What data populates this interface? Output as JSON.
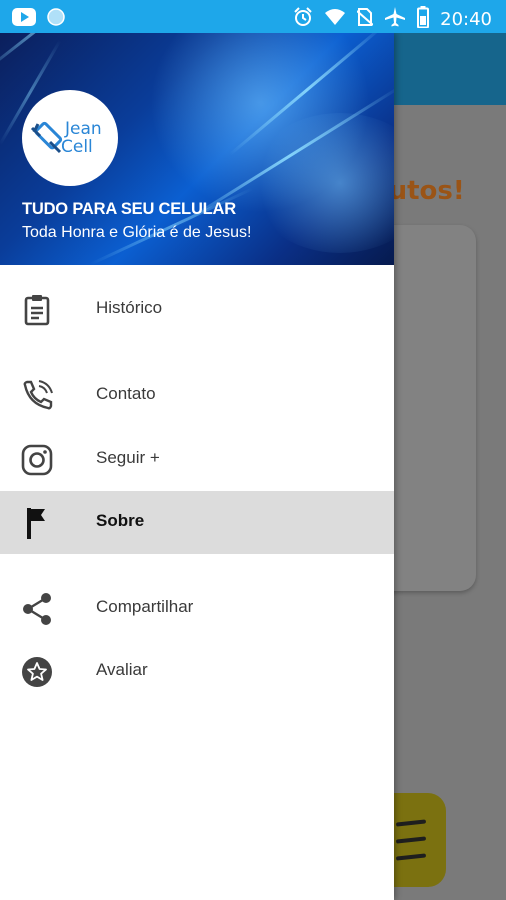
{
  "status_bar": {
    "time": "20:40",
    "left_icons": [
      "youtube-icon",
      "circle-icon"
    ],
    "right_icons": [
      "alarm-icon",
      "wifi-icon",
      "no-sim-icon",
      "airplane-icon",
      "battery-icon"
    ],
    "color": "#1ea7ea"
  },
  "background": {
    "heading_fragment": "dutos!"
  },
  "drawer": {
    "logo": {
      "line1": "Jean",
      "line2": "Cell"
    },
    "title": "TUDO PARA SEU CELULAR",
    "subtitle": "Toda Honra e Glória é de Jesus!",
    "items": [
      {
        "label": "Histórico",
        "icon": "clipboard-icon"
      },
      {
        "label": "Contato",
        "icon": "phone-icon"
      },
      {
        "label": "Seguir +",
        "icon": "instagram-icon"
      },
      {
        "label": "Sobre",
        "icon": "flag-icon",
        "selected": true
      },
      {
        "label": "Compartilhar",
        "icon": "share-icon"
      },
      {
        "label": "Avaliar",
        "icon": "star-icon"
      }
    ]
  }
}
